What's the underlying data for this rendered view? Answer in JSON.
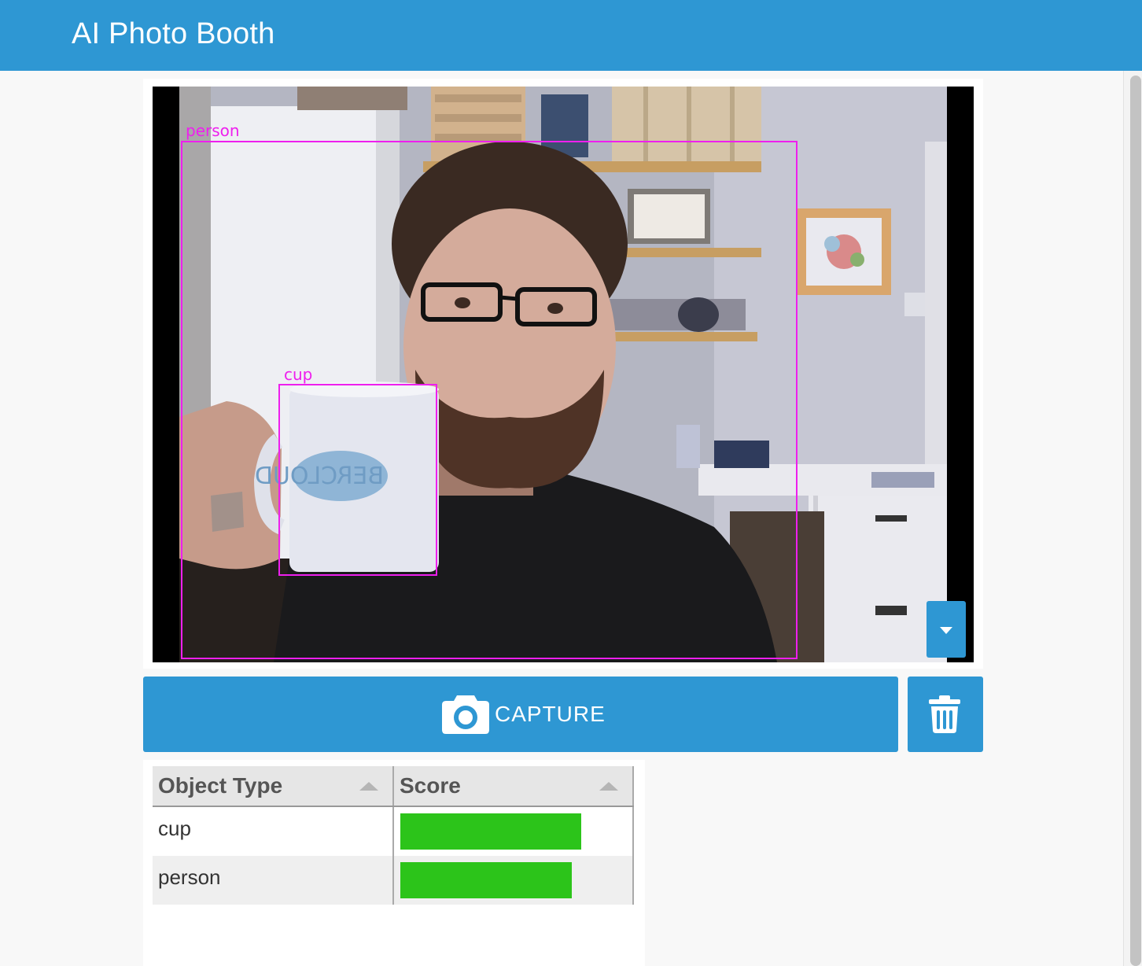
{
  "header": {
    "title": "AI Photo Booth"
  },
  "camera": {
    "detections": [
      {
        "label": "person"
      },
      {
        "label": "cup"
      }
    ],
    "mug_text": "BERCLOUD"
  },
  "controls": {
    "capture_label": "CAPTURE",
    "capture_icon": "camera-icon",
    "delete_icon": "trash-icon",
    "dropdown_icon": "caret-down-icon"
  },
  "results_table": {
    "columns": [
      "Object Type",
      "Score"
    ],
    "rows": [
      {
        "object_type": "cup",
        "score_fraction": 0.78
      },
      {
        "object_type": "person",
        "score_fraction": 0.74
      }
    ]
  },
  "colors": {
    "accent": "#2e97d3",
    "detection_box": "#ee1fee",
    "score_bar": "#2cc41a"
  }
}
